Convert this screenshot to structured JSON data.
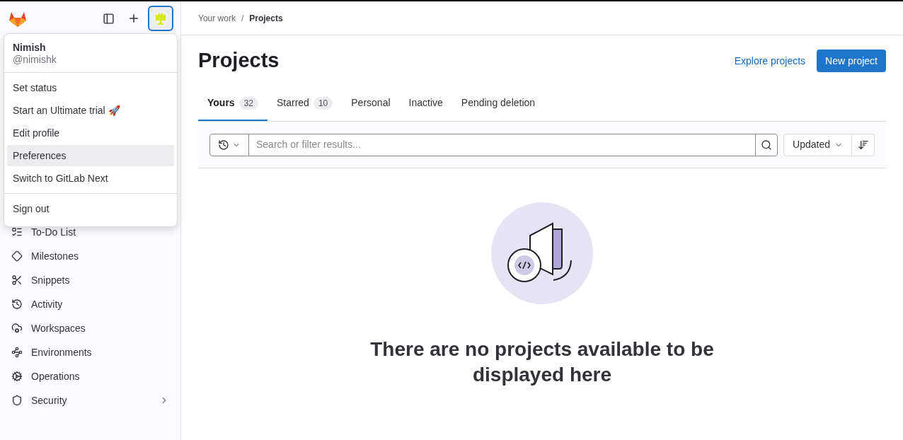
{
  "user_menu": {
    "name": "Nimish",
    "handle": "@nimishk",
    "groups": [
      [
        {
          "label": "Set status",
          "selected": false
        },
        {
          "label": "Start an Ultimate trial",
          "emoji": "🚀",
          "selected": false
        },
        {
          "label": "Edit profile",
          "selected": false
        },
        {
          "label": "Preferences",
          "selected": true
        },
        {
          "label": "Switch to GitLab Next",
          "selected": false
        }
      ],
      [
        {
          "label": "Sign out",
          "selected": false
        }
      ]
    ]
  },
  "sidebar": {
    "items": [
      {
        "label": "To-Do List",
        "has_children": false
      },
      {
        "label": "Milestones",
        "has_children": false
      },
      {
        "label": "Snippets",
        "has_children": false
      },
      {
        "label": "Activity",
        "has_children": false
      },
      {
        "label": "Workspaces",
        "has_children": false
      },
      {
        "label": "Environments",
        "has_children": false
      },
      {
        "label": "Operations",
        "has_children": false
      },
      {
        "label": "Security",
        "has_children": true
      }
    ]
  },
  "breadcrumb": {
    "items": [
      "Your work",
      "Projects"
    ],
    "separator": "/"
  },
  "page_title": "Projects",
  "header_actions": {
    "link": "Explore projects",
    "button": "New project"
  },
  "tabs": [
    {
      "label": "Yours",
      "count": "32",
      "selected": true
    },
    {
      "label": "Starred",
      "count": "10",
      "selected": false
    },
    {
      "label": "Personal",
      "selected": false
    },
    {
      "label": "Inactive",
      "selected": false
    },
    {
      "label": "Pending deletion",
      "selected": false
    }
  ],
  "filter": {
    "placeholder": "Search or filter results...",
    "sort": "Updated"
  },
  "empty_state": {
    "message": "There are no projects available to be displayed here"
  }
}
